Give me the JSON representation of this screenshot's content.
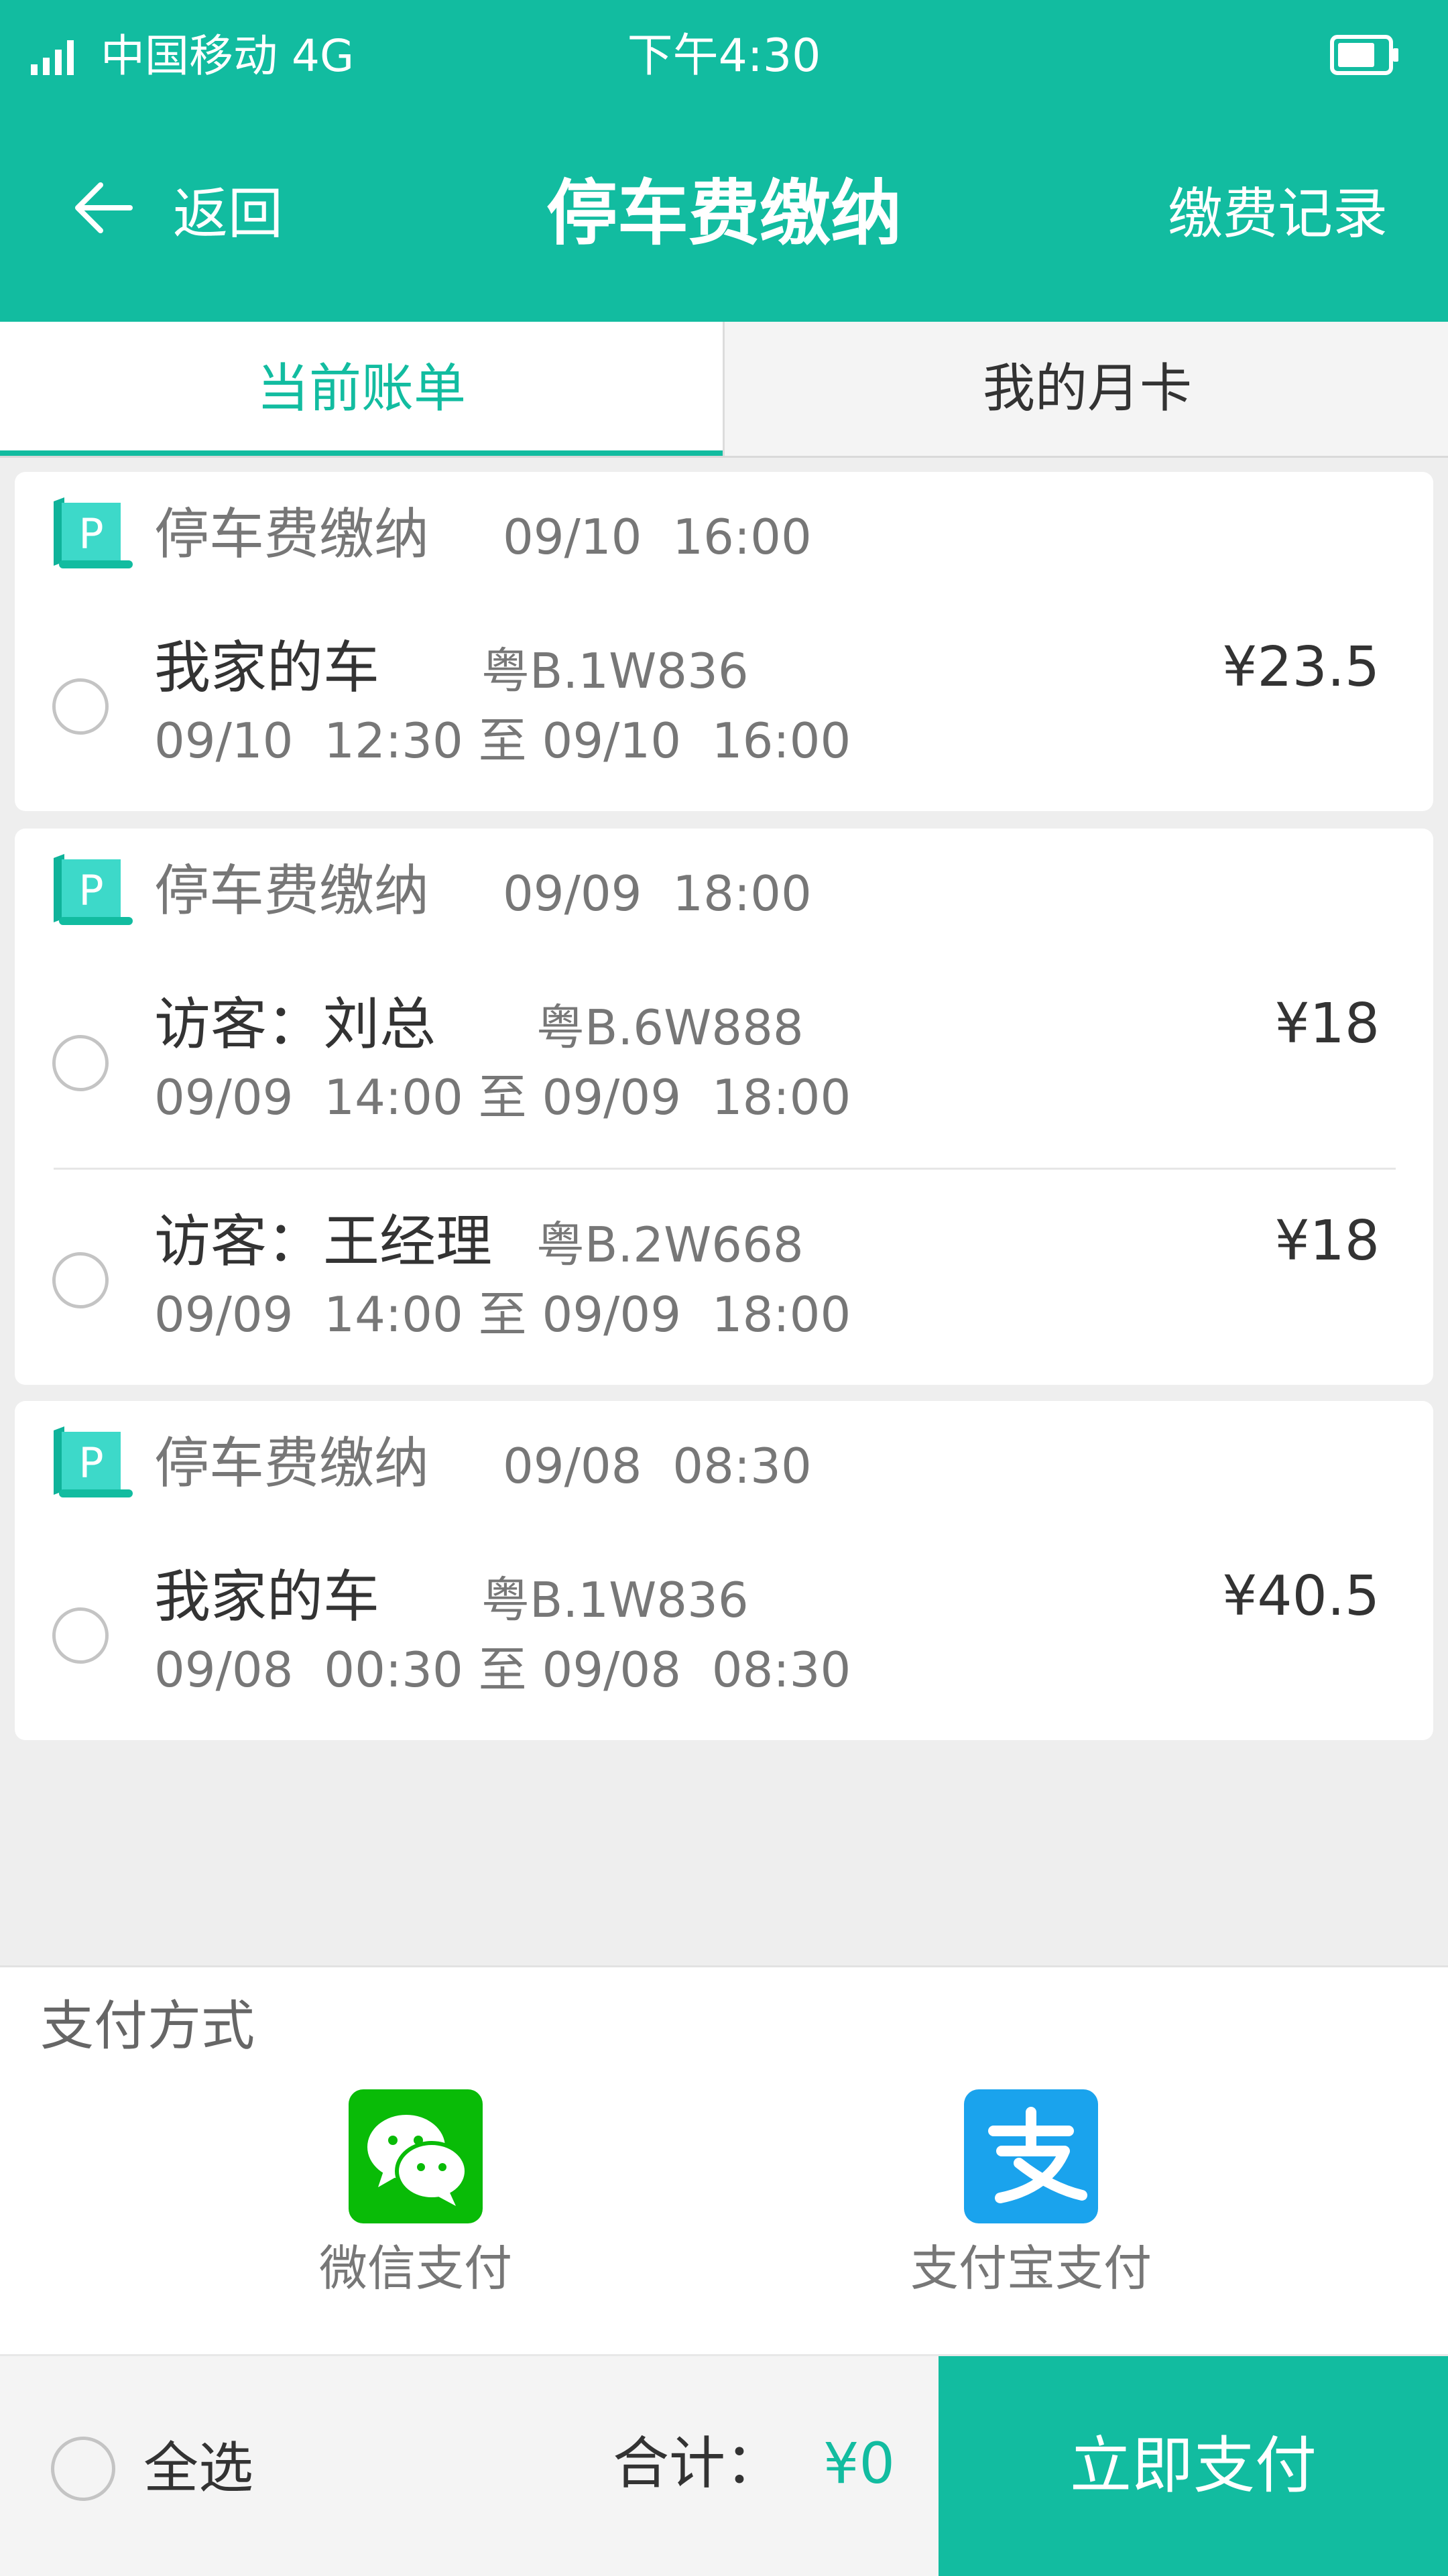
{
  "status_bar": {
    "carrier": "中国移动  4G",
    "time": "下午4:30"
  },
  "nav": {
    "back_label": "返回",
    "title": "停车费缴纳",
    "records_label": "缴费记录"
  },
  "tabs": [
    {
      "label": "当前账单"
    },
    {
      "label": "我的月卡"
    }
  ],
  "bills": [
    {
      "title": "停车费缴纳",
      "time": "09/10  16:00",
      "items": [
        {
          "name": "我家的车",
          "plate": "粤B.1W836",
          "price": "¥23.5",
          "range": "09/10  12:30 至 09/10  16:00"
        }
      ]
    },
    {
      "title": "停车费缴纳",
      "time": "09/09  18:00",
      "items": [
        {
          "name": "访客：刘总",
          "plate": "粤B.6W888",
          "price": "¥18",
          "range": "09/09  14:00 至 09/09  18:00"
        },
        {
          "name": "访客：王经理",
          "plate": "粤B.2W668",
          "price": "¥18",
          "range": "09/09  14:00 至 09/09  18:00"
        }
      ]
    },
    {
      "title": "停车费缴纳",
      "time": "09/08  08:30",
      "items": [
        {
          "name": "我家的车",
          "plate": "粤B.1W836",
          "price": "¥40.5",
          "range": "09/08  00:30 至 09/08  08:30"
        }
      ]
    }
  ],
  "payment": {
    "title": "支付方式",
    "options": [
      {
        "label": "微信支付"
      },
      {
        "label": "支付宝支付"
      }
    ]
  },
  "footer": {
    "select_all": "全选",
    "total_label": "合计：",
    "total_value": "¥0",
    "pay_button": "立即支付"
  },
  "colors": {
    "accent": "#12bca0",
    "wechat": "#09bb07",
    "alipay": "#1aa3ed"
  }
}
